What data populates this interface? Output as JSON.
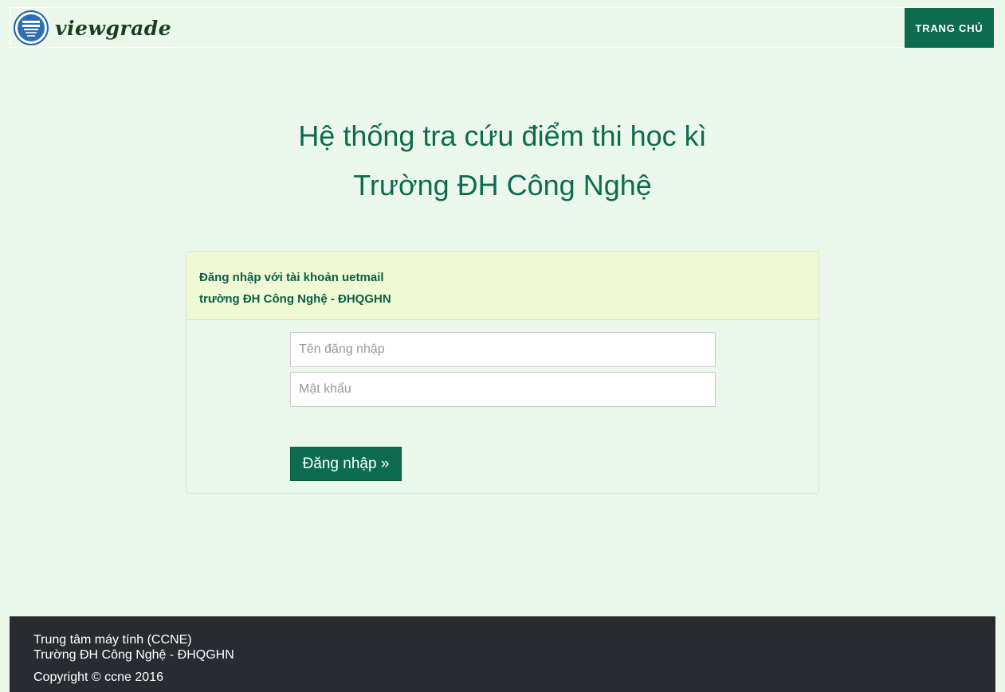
{
  "navbar": {
    "brand_name": "viewgrade",
    "logo_icon": "university-logo-icon",
    "home_label": "TRANG CHỦ"
  },
  "hero": {
    "title_line1": "Hệ thống tra cứu điểm thi học kì",
    "title_line2": "Trường ĐH Công Nghệ"
  },
  "login": {
    "header_line1": "Đăng nhập với tài khoản uetmail",
    "header_line2": "trường ĐH Công Nghệ - ĐHQGHN",
    "username_placeholder": "Tên đăng nhập",
    "username_value": "",
    "password_placeholder": "Mật khẩu",
    "password_value": "",
    "submit_label": "Đăng nhập »"
  },
  "footer": {
    "line1": "Trung tâm máy tính (CCNE)",
    "line2": "Trường ĐH Công Nghệ - ĐHQGHN",
    "copyright": "Copyright © ccne 2016"
  },
  "colors": {
    "primary": "#0d6b50",
    "background": "#ecf7ec",
    "card_header": "#effad5",
    "footer": "#282c30"
  }
}
